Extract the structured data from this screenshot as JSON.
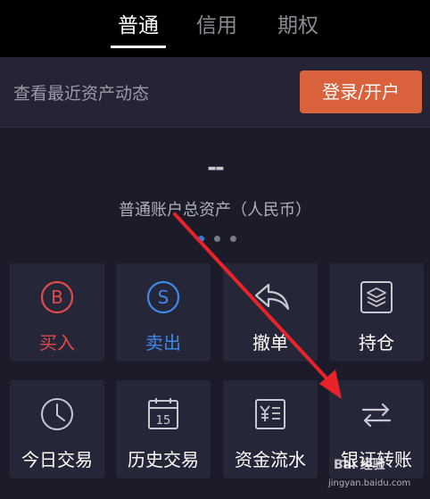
{
  "tabs": [
    {
      "label": "普通",
      "active": true
    },
    {
      "label": "信用",
      "active": false
    },
    {
      "label": "期权",
      "active": false
    }
  ],
  "asset_bar": {
    "text": "查看最近资产动态",
    "login_label": "登录/开户"
  },
  "asset": {
    "value": "--",
    "label": "普通账户总资产（人民币）",
    "page_count": 3,
    "active_page": 1
  },
  "grid": [
    {
      "label": "买入",
      "icon": "buy-icon"
    },
    {
      "label": "卖出",
      "icon": "sell-icon"
    },
    {
      "label": "撤单",
      "icon": "undo-icon"
    },
    {
      "label": "持仓",
      "icon": "layers-icon"
    },
    {
      "label": "今日交易",
      "icon": "clock-icon"
    },
    {
      "label": "历史交易",
      "icon": "calendar-icon"
    },
    {
      "label": "资金流水",
      "icon": "cashbook-icon"
    },
    {
      "label": "银证转账",
      "icon": "transfer-icon"
    }
  ],
  "calendar_day": "15",
  "watermark": {
    "brand": "Bai 经验",
    "url": "jingyan.baidu.com"
  },
  "colors": {
    "accent_orange": "#d9623d",
    "buy_red": "#e14b4b",
    "sell_blue": "#3f88e8",
    "annotation_red": "#e8242a"
  }
}
